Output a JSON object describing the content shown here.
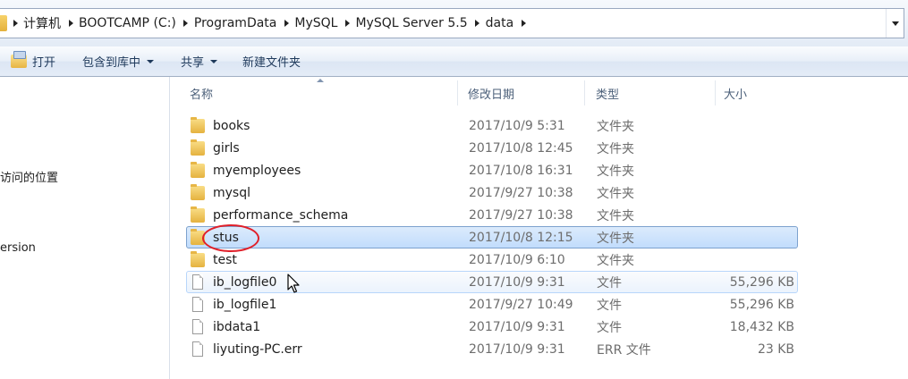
{
  "breadcrumb": [
    "计算机",
    "BOOTCAMP (C:)",
    "ProgramData",
    "MySQL",
    "MySQL Server 5.5",
    "data"
  ],
  "toolbar": {
    "open": "打开",
    "include_library": "包含到库中",
    "share": "共享",
    "new_folder": "新建文件夹"
  },
  "nav": {
    "recent": "访问的位置",
    "version": "ersion"
  },
  "columns": {
    "name": "名称",
    "date": "修改日期",
    "type": "类型",
    "size": "大小"
  },
  "files": [
    {
      "name": "books",
      "date": "2017/10/9 5:31",
      "type": "文件夹",
      "size": "",
      "kind": "folder"
    },
    {
      "name": "girls",
      "date": "2017/10/8 12:45",
      "type": "文件夹",
      "size": "",
      "kind": "folder"
    },
    {
      "name": "myemployees",
      "date": "2017/10/8 16:31",
      "type": "文件夹",
      "size": "",
      "kind": "folder"
    },
    {
      "name": "mysql",
      "date": "2017/9/27 10:38",
      "type": "文件夹",
      "size": "",
      "kind": "folder"
    },
    {
      "name": "performance_schema",
      "date": "2017/9/27 10:38",
      "type": "文件夹",
      "size": "",
      "kind": "folder"
    },
    {
      "name": "stus",
      "date": "2017/10/8 12:15",
      "type": "文件夹",
      "size": "",
      "kind": "folder",
      "selected": true
    },
    {
      "name": "test",
      "date": "2017/10/9 6:10",
      "type": "文件夹",
      "size": "",
      "kind": "folder"
    },
    {
      "name": "ib_logfile0",
      "date": "2017/10/9 9:31",
      "type": "文件",
      "size": "55,296 KB",
      "kind": "file",
      "hover": true
    },
    {
      "name": "ib_logfile1",
      "date": "2017/9/27 10:49",
      "type": "文件",
      "size": "55,296 KB",
      "kind": "file"
    },
    {
      "name": "ibdata1",
      "date": "2017/10/9 9:31",
      "type": "文件",
      "size": "18,432 KB",
      "kind": "file"
    },
    {
      "name": "liyuting-PC.err",
      "date": "2017/10/9 9:31",
      "type": "ERR 文件",
      "size": "23 KB",
      "kind": "file"
    }
  ]
}
